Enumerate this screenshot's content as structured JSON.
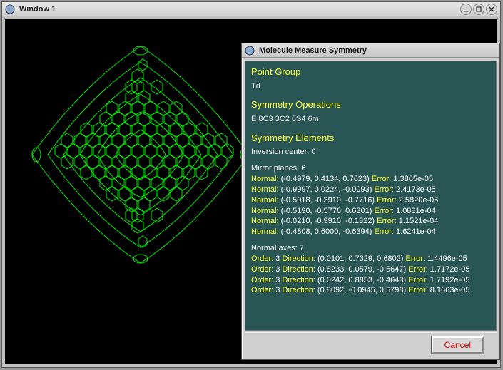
{
  "mainWindow": {
    "title": "Window 1"
  },
  "dialog": {
    "title": "Molecule Measure Symmetry",
    "pointGroup": {
      "heading": "Point Group",
      "value": "Td"
    },
    "symOps": {
      "heading": "Symmetry Operations",
      "value": "E 8C3 3C2 6S4 6m"
    },
    "symElems": {
      "heading": "Symmetry Elements",
      "inversion": "Inversion center: 0",
      "mirrorHeading": "Mirror planes: 6",
      "mirrors": [
        {
          "normal": "(-0.4979, 0.4134, 0.7623)",
          "error": "1.3865e-05"
        },
        {
          "normal": "(-0.9997, 0.0224, -0.0093)",
          "error": "2.4173e-05"
        },
        {
          "normal": "(-0.5018, -0.3910, -0.7716)",
          "error": "2.5820e-05"
        },
        {
          "normal": "(-0.5190, -0.5776, 0.6301)",
          "error": "1.0881e-04"
        },
        {
          "normal": "(-0.0210, -0.9910, -0.1322)",
          "error": "1.1521e-04"
        },
        {
          "normal": "(-0.4808, 0.6000, -0.6394)",
          "error": "1.6241e-04"
        }
      ],
      "axesHeading": "Normal axes: 7",
      "axes": [
        {
          "order": "3",
          "direction": "(0.0101, 0.7329, 0.6802)",
          "error": "1.4496e-05"
        },
        {
          "order": "3",
          "direction": "(0.8233, 0.0579, -0.5647)",
          "error": "1.7172e-05"
        },
        {
          "order": "3",
          "direction": "(0.0242, 0.8853, -0.4643)",
          "error": "1.7192e-05"
        },
        {
          "order": "3",
          "direction": "(0.8092, -0.0945, 0.5798)",
          "error": "8.1663e-05"
        }
      ]
    },
    "cancelLabel": "Cancel"
  },
  "labels": {
    "normal": "Normal:",
    "error": "Error:",
    "order": "Order:",
    "direction": "Direction:"
  }
}
